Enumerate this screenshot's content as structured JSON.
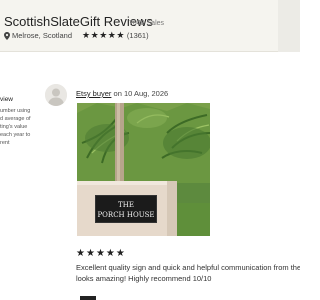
{
  "shop": {
    "name": "ScottishSlateGift Reviews",
    "sales": "7048 Sales",
    "location": "Melrose, Scotland",
    "rating_stars": [
      "★",
      "★",
      "★",
      "★",
      "★"
    ],
    "review_count": "(1361)"
  },
  "sidebar": {
    "title": "view",
    "lines": [
      "umber using",
      "d average of",
      "ting's value",
      "each year to",
      "rent"
    ]
  },
  "review": {
    "reviewer_name": "Etsy buyer",
    "date_text": " on 10 Aug, 2026",
    "stars": [
      "★",
      "★",
      "★",
      "★",
      "★"
    ],
    "text_line1": "Excellent quality sign and quick and helpful communication from the",
    "text_line2": "looks amazing! Highly recommend 10/10",
    "photo": {
      "sign_line1": "THE",
      "sign_line2": "PORCH HOUSE"
    }
  },
  "colors": {
    "header_bg": "#f5f4ef",
    "star": "#222222",
    "sign": "#1b1b1b"
  },
  "icons": {
    "location": "location-pin-icon",
    "avatar": "default-avatar-icon"
  }
}
